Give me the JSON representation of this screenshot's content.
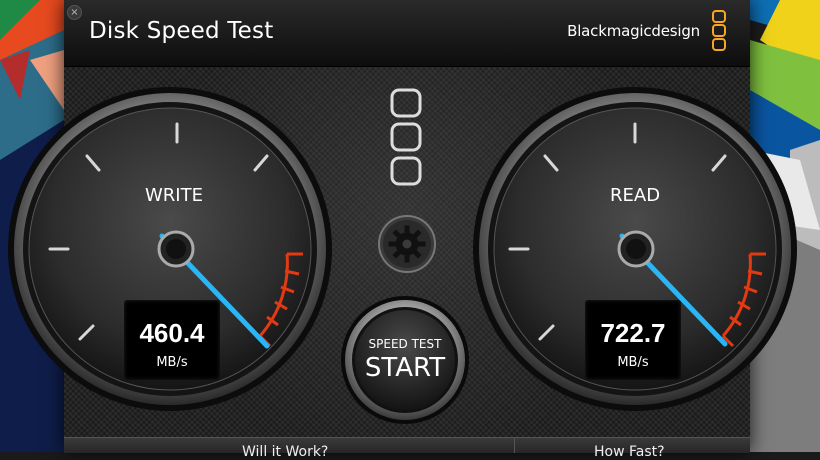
{
  "app": {
    "title": "Disk Speed Test",
    "brand": "Blackmagicdesign",
    "close_glyph": "×"
  },
  "gauges": {
    "write": {
      "label": "WRITE",
      "value": "460.4",
      "unit": "MB/s",
      "needle_icon": "needle-icon"
    },
    "read": {
      "label": "READ",
      "value": "722.7",
      "unit": "MB/s",
      "needle_icon": "needle-icon"
    }
  },
  "controls": {
    "settings_icon": "gear-icon",
    "start_top": "SPEED TEST",
    "start_main": "START"
  },
  "footer": {
    "left": "Will it Work?",
    "right": "How Fast?"
  },
  "colors": {
    "needle": "#29b6f6",
    "redzone": "#e23a12",
    "brand_logo": "#f5a623"
  }
}
